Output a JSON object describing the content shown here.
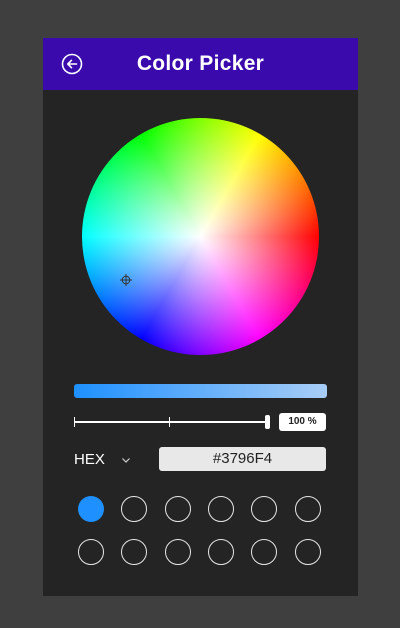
{
  "header": {
    "title": "Color Picker",
    "back_icon": "arrow-left-circle-icon",
    "background": "#3a0aad"
  },
  "color": {
    "selected_hex": "#3796F4",
    "opacity_label": "100 %",
    "opacity_percent": 100,
    "mode": "HEX"
  },
  "swatches": [
    {
      "color": "#1e90ff",
      "filled": true
    },
    {
      "filled": false
    },
    {
      "filled": false
    },
    {
      "filled": false
    },
    {
      "filled": false
    },
    {
      "filled": false
    },
    {
      "filled": false
    },
    {
      "filled": false
    },
    {
      "filled": false
    },
    {
      "filled": false
    },
    {
      "filled": false
    },
    {
      "filled": false
    }
  ]
}
